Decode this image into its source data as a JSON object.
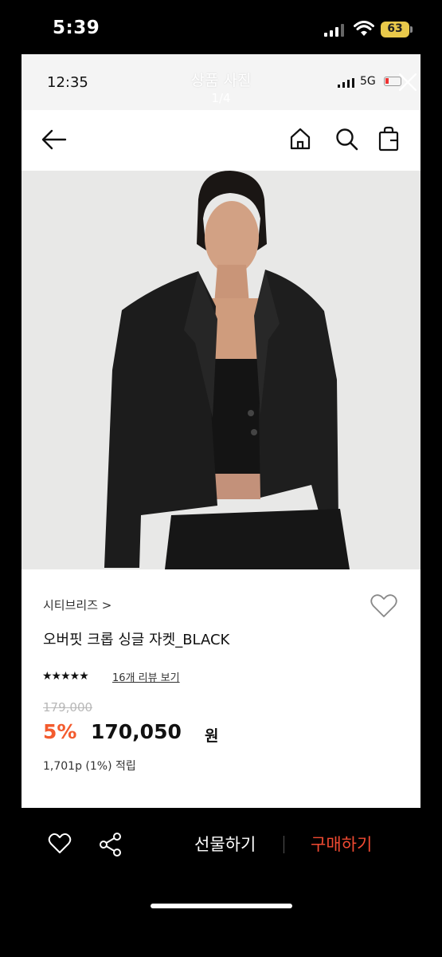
{
  "device_status": {
    "time": "5:39",
    "battery": "63"
  },
  "viewer": {
    "inner_time": "12:35",
    "title": "상품 사진",
    "counter": "1/4",
    "network": "5G"
  },
  "product": {
    "brand": "시티브리즈 >",
    "name": "오버핏 크롭 싱글 자켓_BLACK",
    "stars": "★★★★★",
    "review_link": "16개 리뷰 보기",
    "original_price": "179,000",
    "discount": "5%",
    "sale_price": "170,050",
    "currency": "원",
    "points": "1,701p (1%) 적립"
  },
  "actions": {
    "gift": "선물하기",
    "buy": "구매하기"
  },
  "colors": {
    "accent": "#f35b2e",
    "buy": "#f04a32",
    "battery": "#e9c94a"
  },
  "icons": [
    "signal-icon",
    "wifi-icon",
    "battery-icon",
    "close-icon",
    "back-arrow-icon",
    "home-icon",
    "search-icon",
    "shopping-bag-icon",
    "heart-icon",
    "share-icon"
  ]
}
